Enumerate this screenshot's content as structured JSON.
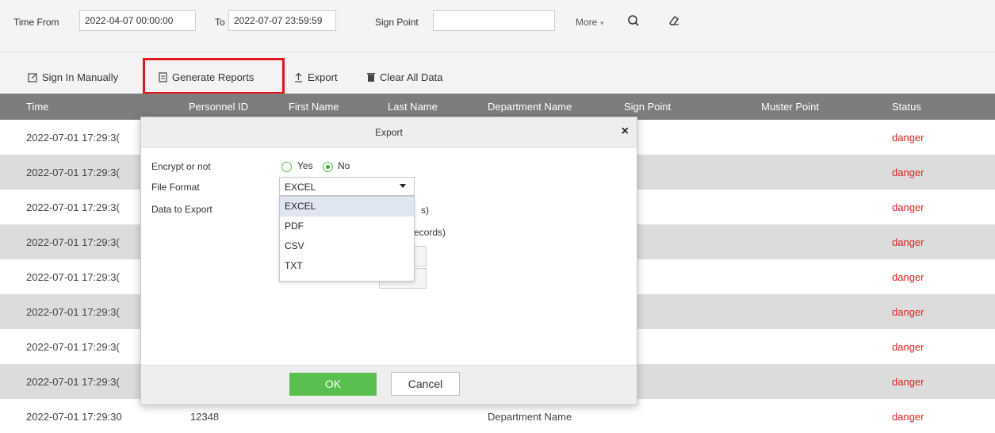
{
  "filter": {
    "time_from_label": "Time From",
    "time_from_value": "2022-04-07 00:00:00",
    "to_label": "To",
    "to_value": "2022-07-07 23:59:59",
    "sign_point_label": "Sign Point",
    "sign_point_value": "",
    "more_label": "More",
    "search_icon": "search-icon",
    "clear_icon": "eraser-icon"
  },
  "toolbar": {
    "sign_in_manually": "Sign In Manually",
    "generate_reports": "Generate Reports",
    "export": "Export",
    "clear_all_data": "Clear All Data"
  },
  "table": {
    "columns": [
      "Time",
      "Personnel ID",
      "First Name",
      "Last Name",
      "Department Name",
      "Sign Point",
      "Muster Point",
      "Status"
    ],
    "rows": [
      {
        "time": "2022-07-01 17:29:3(",
        "status": "danger"
      },
      {
        "time": "2022-07-01 17:29:3(",
        "status": "danger"
      },
      {
        "time": "2022-07-01 17:29:3(",
        "status": "danger"
      },
      {
        "time": "2022-07-01 17:29:3(",
        "status": "danger"
      },
      {
        "time": "2022-07-01 17:29:3(",
        "status": "danger"
      },
      {
        "time": "2022-07-01 17:29:3(",
        "status": "danger"
      },
      {
        "time": "2022-07-01 17:29:3(",
        "status": "danger"
      },
      {
        "time": "2022-07-01 17:29:3(",
        "status": "danger"
      },
      {
        "time": "2022-07-01 17:29:30",
        "personnel_id": "12348",
        "department": "Department Name",
        "status": "danger"
      }
    ]
  },
  "dialog": {
    "title": "Export",
    "close": "×",
    "encrypt_label": "Encrypt or not",
    "yes": "Yes",
    "no": "No",
    "file_format_label": "File Format",
    "file_format_value": "EXCEL",
    "data_to_export_label": "Data to Export",
    "format_options": [
      "EXCEL",
      "PDF",
      "CSV",
      "TXT"
    ],
    "partial_text_1": "s)",
    "partial_text_2": "ecords)",
    "ok": "OK",
    "cancel": "Cancel"
  },
  "colors": {
    "status_danger": "#e02020",
    "ok_green": "#59c04f",
    "highlight_red": "#e5141b",
    "header_gray": "#7d7d7d"
  }
}
